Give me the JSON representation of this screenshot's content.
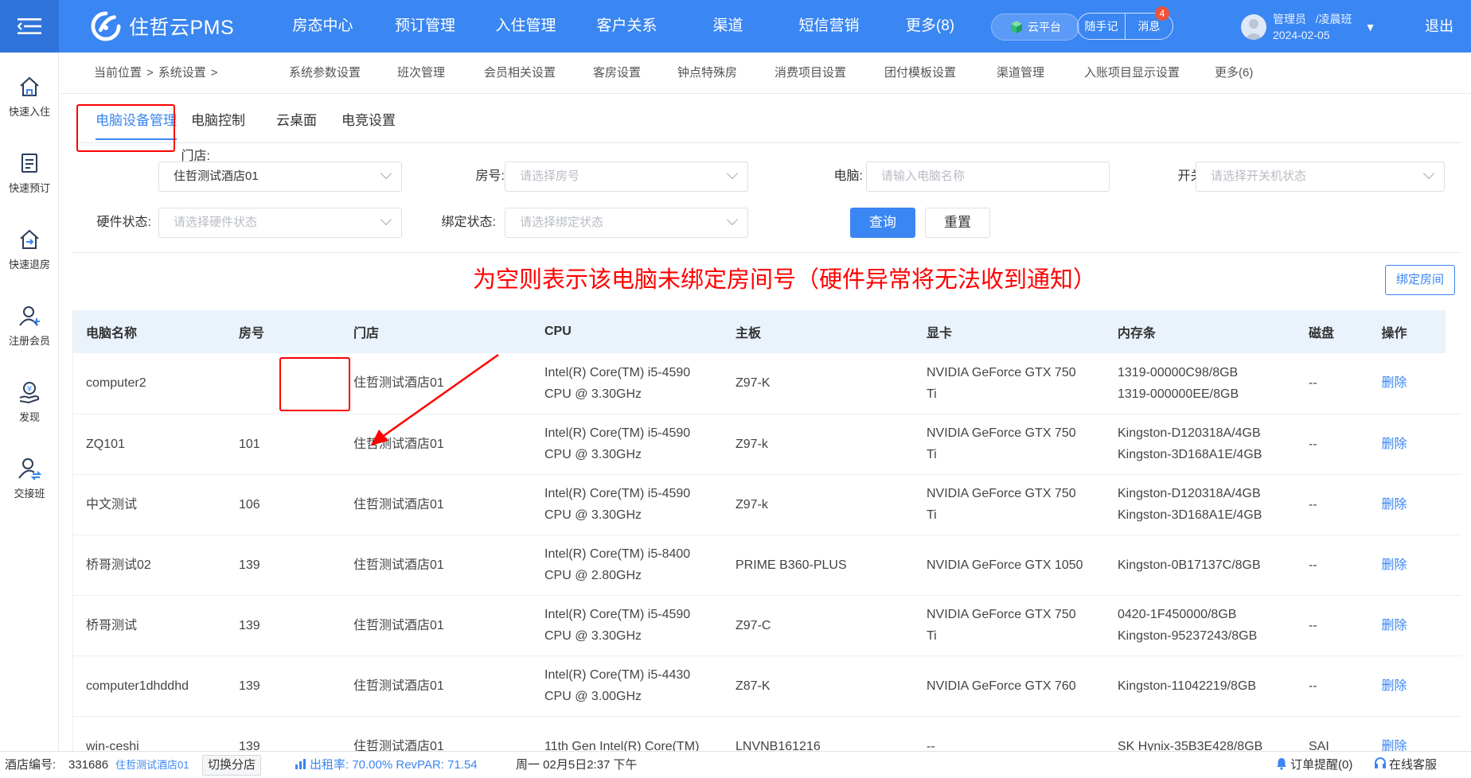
{
  "app": {
    "logo_text": "住哲云PMS",
    "logout": "退出",
    "user": {
      "role": "管理员",
      "shift": "/凌晨班",
      "date": "2024-02-05"
    },
    "cloud_platform": "云平台",
    "notes": "随手记",
    "messages": "消息",
    "message_count": "4"
  },
  "topnav": [
    {
      "label": "房态中心"
    },
    {
      "label": "预订管理"
    },
    {
      "label": "入住管理"
    },
    {
      "label": "客户关系"
    },
    {
      "label": "渠道"
    },
    {
      "label": "短信营销"
    },
    {
      "label": "更多(8)"
    }
  ],
  "sidebar": [
    {
      "label": "快速入住",
      "icon": "home-icon"
    },
    {
      "label": "快速预订",
      "icon": "booking-icon"
    },
    {
      "label": "快速退房",
      "icon": "checkout-icon"
    },
    {
      "label": "注册会员",
      "icon": "member-icon"
    },
    {
      "label": "发现",
      "icon": "discover-icon"
    },
    {
      "label": "交接班",
      "icon": "handover-icon"
    }
  ],
  "breadcrumb": {
    "current": "当前位置",
    "sep": ">",
    "section": "系统设置"
  },
  "subnav": [
    {
      "label": "系统参数设置"
    },
    {
      "label": "班次管理"
    },
    {
      "label": "会员相关设置"
    },
    {
      "label": "客房设置"
    },
    {
      "label": "钟点特殊房"
    },
    {
      "label": "消费项目设置"
    },
    {
      "label": "团付模板设置"
    },
    {
      "label": "渠道管理"
    },
    {
      "label": "入账项目显示设置"
    },
    {
      "label": "更多(6)"
    }
  ],
  "tabs": [
    {
      "label": "电脑设备管理",
      "active": true
    },
    {
      "label": "电脑控制"
    },
    {
      "label": "云桌面"
    },
    {
      "label": "电竞设置"
    }
  ],
  "filters": {
    "store": {
      "label": "门店:",
      "value": "住哲测试酒店01"
    },
    "room": {
      "label": "房号:",
      "placeholder": "请选择房号"
    },
    "computer": {
      "label": "电脑:",
      "placeholder": "请输入电脑名称"
    },
    "power": {
      "label": "开关机状态:",
      "placeholder": "请选择开关机状态"
    },
    "hardware": {
      "label": "硬件状态:",
      "placeholder": "请选择硬件状态"
    },
    "binding": {
      "label": "绑定状态:",
      "placeholder": "请选择绑定状态"
    },
    "query": "查询",
    "reset": "重置"
  },
  "annotation": "为空则表示该电脑未绑定房间号（硬件异常将无法收到通知）",
  "bind_room_button": "绑定房间",
  "table": {
    "headers": [
      "电脑名称",
      "房号",
      "门店",
      "CPU",
      "主板",
      "显卡",
      "内存条",
      "磁盘",
      "操作"
    ],
    "rows": [
      [
        "computer2",
        "",
        "住哲测试酒店01",
        "Intel(R) Core(TM) i5-4590\nCPU @ 3.30GHz",
        "Z97-K",
        "NVIDIA GeForce GTX 750\nTi",
        "1319-00000C98/8GB\n1319-000000EE/8GB",
        "--",
        "删除"
      ],
      [
        "ZQ101",
        "101",
        "住哲测试酒店01",
        "Intel(R) Core(TM) i5-4590\nCPU @ 3.30GHz",
        "Z97-k",
        "NVIDIA GeForce GTX 750\nTi",
        "Kingston-D120318A/4GB\nKingston-3D168A1E/4GB",
        "--",
        "删除"
      ],
      [
        "中文测试",
        "106",
        "住哲测试酒店01",
        "Intel(R) Core(TM) i5-4590\nCPU @ 3.30GHz",
        "Z97-k",
        "NVIDIA GeForce GTX 750\nTi",
        "Kingston-D120318A/4GB\nKingston-3D168A1E/4GB",
        "--",
        "删除"
      ],
      [
        "桥哥测试02",
        "139",
        "住哲测试酒店01",
        "Intel(R) Core(TM) i5-8400\nCPU @ 2.80GHz",
        "PRIME B360-PLUS",
        "NVIDIA GeForce GTX 1050",
        "Kingston-0B17137C/8GB",
        "--",
        "删除"
      ],
      [
        "桥哥测试",
        "139",
        "住哲测试酒店01",
        "Intel(R) Core(TM) i5-4590\nCPU @ 3.30GHz",
        "Z97-C",
        "NVIDIA GeForce GTX 750\nTi",
        "0420-1F450000/8GB\nKingston-95237243/8GB",
        "--",
        "删除"
      ],
      [
        "computer1dhddhd",
        "139",
        "住哲测试酒店01",
        "Intel(R) Core(TM) i5-4430\nCPU @ 3.00GHz",
        "Z87-K",
        "NVIDIA GeForce GTX 760",
        "Kingston-11042219/8GB",
        "--",
        "删除"
      ],
      [
        "win-ceshi",
        "139",
        "住哲测试酒店01",
        "11th Gen Intel(R) Core(TM)",
        "LNVNB161216",
        "--",
        "SK Hynix-35B3E428/8GB",
        "SAI",
        "删除"
      ]
    ]
  },
  "footer": {
    "hotel_no_label": "酒店编号:",
    "hotel_no": "331686",
    "hotel_name": "住哲测试酒店01",
    "switch": "切换分店",
    "occupancy": "出租率: 70.00% RevPAR: 71.54",
    "datetime": "周一 02月5日2:37 下午",
    "order_reminder": "订单提醒(0)",
    "support": "在线客服"
  }
}
